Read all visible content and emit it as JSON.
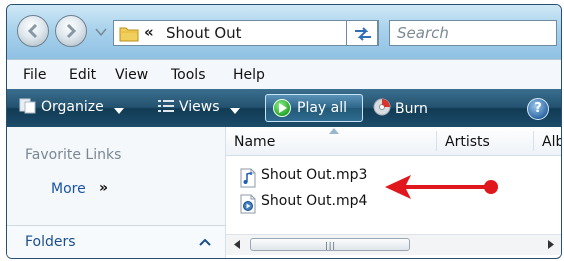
{
  "address": {
    "chevron": "«",
    "path": "Shout Out"
  },
  "search": {
    "placeholder": "Search"
  },
  "menu": [
    "File",
    "Edit",
    "View",
    "Tools",
    "Help"
  ],
  "toolbar": {
    "organize": "Organize",
    "views": "Views",
    "play_all": "Play all",
    "burn": "Burn",
    "help": "?"
  },
  "sidebar": {
    "favorite_links": "Favorite Links",
    "more": "More",
    "more_glyph": "»",
    "folders": "Folders"
  },
  "columns": [
    "Name",
    "Artists",
    "Alb"
  ],
  "files": [
    {
      "name": "Shout Out.mp3",
      "icon": "audio-file-icon"
    },
    {
      "name": "Shout Out.mp4",
      "icon": "video-file-icon"
    }
  ],
  "scrollbar": {
    "grip": "|||"
  },
  "colors": {
    "annotation_arrow": "#e0171c",
    "command_bar": "#1c4c69"
  }
}
